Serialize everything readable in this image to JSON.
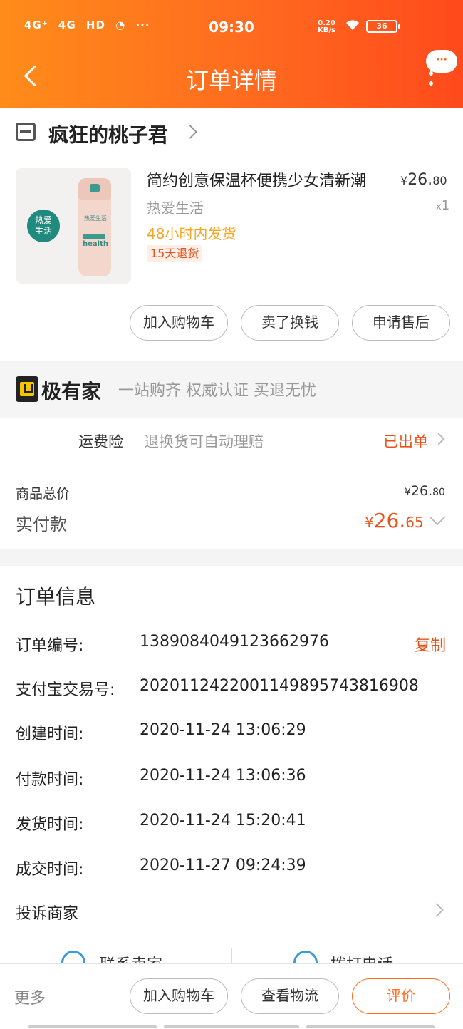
{
  "status_bar": {
    "signal1": "4G⁺",
    "signal2": "4G",
    "hd": "HD",
    "wechat": "◔",
    "dots": "···",
    "time": "09:30",
    "speed_value": "0.20",
    "speed_unit": "KB/s",
    "battery": "36"
  },
  "header": {
    "title": "订单详情",
    "more_bubble": "···"
  },
  "store": {
    "name": "疯狂的桃子君"
  },
  "product": {
    "badge": "热爱\n生活",
    "cup_text": "热爱生活",
    "cup_health": "health",
    "title": "简约创意保温杯便携少女清新潮",
    "price_currency": "¥",
    "price_int": "26.",
    "price_dec": "80",
    "sku": "热爱生活",
    "qty_x": "x",
    "qty": "1",
    "ship_note": "48小时内发货",
    "return_tag": "15天退货"
  },
  "item_actions": {
    "add_cart": "加入购物车",
    "sell": "卖了换钱",
    "after_sale": "申请售后"
  },
  "jiyoujia": {
    "name": "极有家",
    "slogan": "一站购齐 权威认证 买退无忧"
  },
  "insurance": {
    "label": "运费险",
    "desc": "退换货可自动理赔",
    "status": "已出单"
  },
  "totals": {
    "subtotal_label": "商品总价",
    "subtotal_currency": "¥",
    "subtotal_int": "26.",
    "subtotal_dec": "80",
    "paid_label": "实付款",
    "paid_currency": "¥",
    "paid_int": "26.",
    "paid_dec": "65"
  },
  "order_info": {
    "title": "订单信息",
    "copy": "复制",
    "rows": [
      {
        "key": "订单编号:",
        "value": "1389084049123662976"
      },
      {
        "key": "支付宝交易号:",
        "value": "2020112422001149895743816908"
      },
      {
        "key": "创建时间:",
        "value": "2020-11-24 13:06:29"
      },
      {
        "key": "付款时间:",
        "value": "2020-11-24 13:06:36"
      },
      {
        "key": "发货时间:",
        "value": "2020-11-24 15:20:41"
      },
      {
        "key": "成交时间:",
        "value": "2020-11-27 09:24:39"
      }
    ],
    "complain": "投诉商家",
    "contact_seller": "联系卖家",
    "call_phone": "拨打电话"
  },
  "bottom_bar": {
    "more": "更多",
    "add_cart": "加入购物车",
    "logistics": "查看物流",
    "review": "评价"
  },
  "colors": {
    "header_gradient_start": "#ff8c1a",
    "header_gradient_end": "#ff4a1c",
    "accent": "#e8521a",
    "ship_note": "#f5a623"
  }
}
